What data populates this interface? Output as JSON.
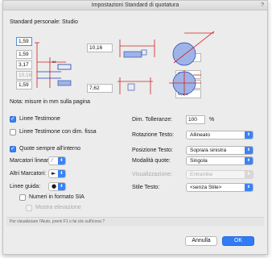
{
  "dialog": {
    "title": "Impostazioni Standard di quotatura",
    "help": "?",
    "standard_label": "Standard personale: Studio"
  },
  "diagram": {
    "left_fields": [
      "1,59",
      "1,59",
      "3,17",
      "10,16",
      "1,59"
    ],
    "mid_top": "10,16",
    "mid_bottom": "7,62",
    "right_top": "6,35",
    "right_fields": [
      "3,17",
      "1,59",
      "6,36"
    ]
  },
  "note": "Nota: misure in mm sulla pagina",
  "options": {
    "linee_testimone": "Linee Testimone",
    "linee_testimone_fissa": "Linee Testimone con dim. fissa",
    "quote_interno": "Quote sempre all'interno",
    "marcatori_lineari": "Marcatori lineari:",
    "altri_marcatori": "Altri Marcatori:",
    "linee_guida": "Linee guida:",
    "numeri_sia": "Numeri in formato SIA",
    "mostra_elevazione": "Mostra elevazione"
  },
  "right": {
    "dim_tolleranze": "Dim. Tolleranze:",
    "dim_value": "100",
    "dim_unit": "%",
    "rotazione_label": "Rotazione Testo:",
    "rotazione_value": "Allineato",
    "posizione_label": "Posizione Testo:",
    "posizione_value": "Sopra/a sinistra",
    "modalita_label": "Modalità quote:",
    "modalita_value": "Singola",
    "visualizzazione_label": "Visualizzazione:",
    "visualizzazione_value": "Entrambe",
    "stile_label": "Stile Testo:",
    "stile_value": "<senza Stile>"
  },
  "hint": "Per visualizzare l'Aiuto, premi F1 o fai clic sull'icona ?",
  "buttons": {
    "cancel": "Annulla",
    "ok": "OK"
  }
}
